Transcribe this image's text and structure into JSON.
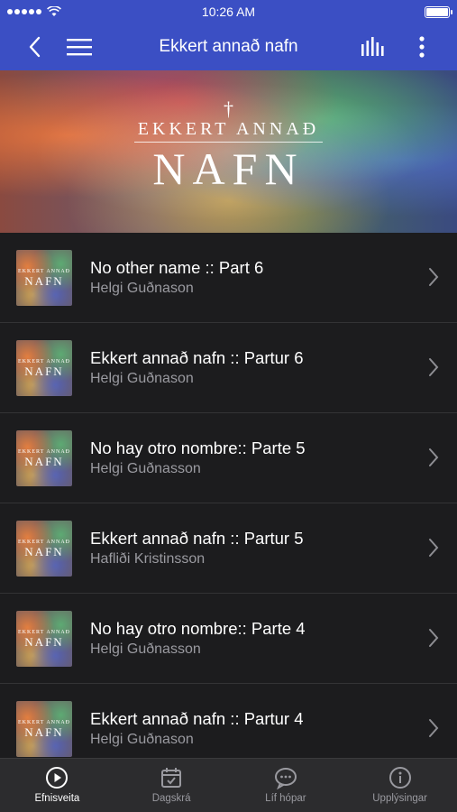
{
  "status_bar": {
    "time": "10:26 AM"
  },
  "nav": {
    "title": "Ekkert annað nafn",
    "icons": [
      "back-chevron-icon",
      "hamburger-menu-icon",
      "audio-bars-icon",
      "more-vertical-icon"
    ]
  },
  "hero": {
    "top_text": "EKKERT ANNAÐ",
    "main_text": "NAFN"
  },
  "thumb": {
    "top_text": "EKKERT ANNAÐ",
    "main_text": "NAFN"
  },
  "items": [
    {
      "title": "No other name :: Part 6",
      "subtitle": "Helgi Guðnason"
    },
    {
      "title": "Ekkert annað nafn :: Partur 6",
      "subtitle": "Helgi Guðnason"
    },
    {
      "title": "No hay otro nombre:: Parte 5",
      "subtitle": "Helgi Guðnasson"
    },
    {
      "title": "Ekkert annað nafn :: Partur 5",
      "subtitle": "Hafliði Kristinsson"
    },
    {
      "title": "No hay otro nombre:: Parte 4",
      "subtitle": "Helgi Guðnasson"
    },
    {
      "title": "Ekkert annað nafn :: Partur 4",
      "subtitle": "Helgi Guðnason"
    }
  ],
  "tabs": [
    {
      "label": "Efnisveita",
      "icon": "play-circle-icon",
      "active": true
    },
    {
      "label": "Dagskrá",
      "icon": "calendar-check-icon",
      "active": false
    },
    {
      "label": "Líf hópar",
      "icon": "chat-bubble-icon",
      "active": false
    },
    {
      "label": "Upplýsingar",
      "icon": "info-circle-icon",
      "active": false
    }
  ],
  "colors": {
    "nav_bg": "#3b4fc4",
    "list_bg": "#1c1c1e",
    "tab_bg": "#2c2c2e"
  }
}
